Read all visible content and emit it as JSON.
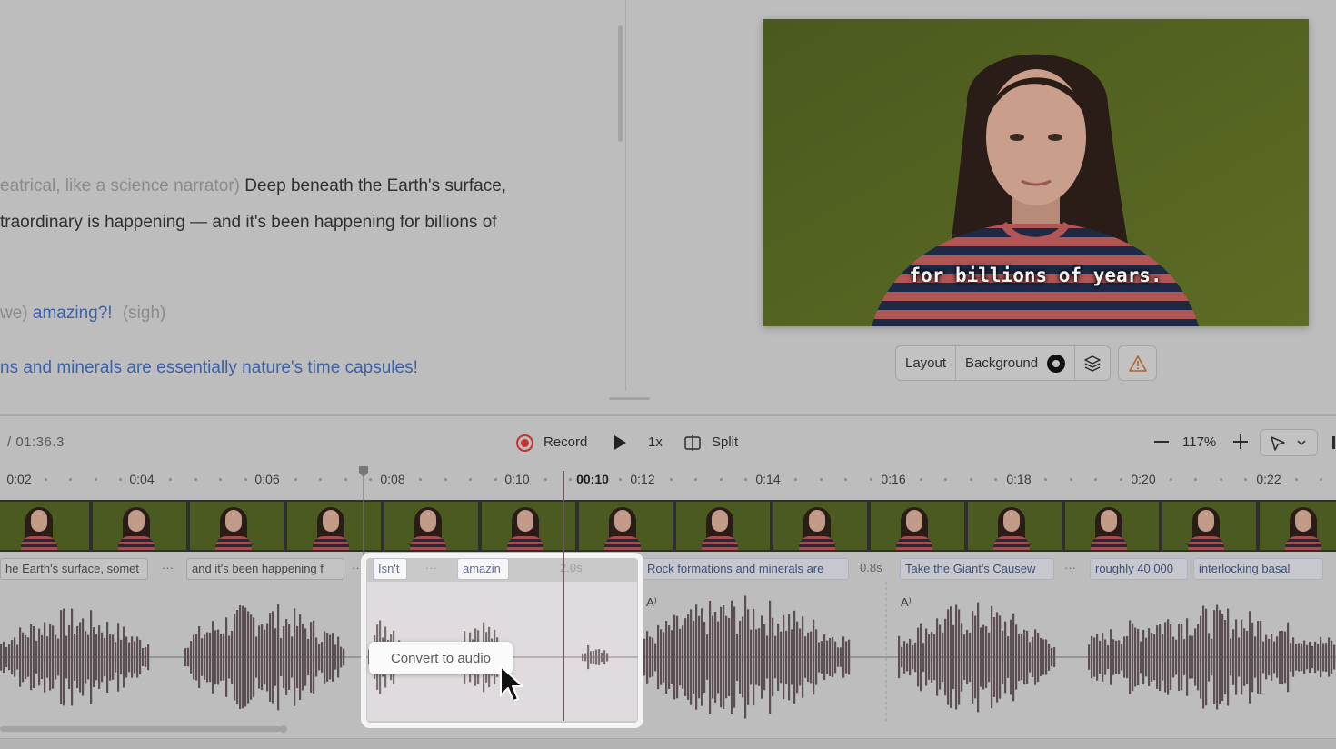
{
  "script": {
    "line1_direction": "eatrical, like a science narrator)",
    "line1_text": "Deep beneath the Earth's surface,",
    "line2_text": "traordinary is happening — and it's been happening for billions of",
    "line3_direction": "we)",
    "line3_word": "amazing?!",
    "line3_tag": "(sigh)",
    "line4_text": "ns and minerals are essentially nature's time capsules!"
  },
  "preview": {
    "caption": "for billions of years.",
    "toolbar": {
      "layout": "Layout",
      "background": "Background"
    }
  },
  "transport": {
    "time": "/  01:36.3",
    "record": "Record",
    "speed": "1x",
    "split": "Split",
    "zoom": "117%"
  },
  "ruler": {
    "labels": [
      "0:02",
      "0:04",
      "0:06",
      "0:08",
      "0:10",
      "00:10",
      "0:12",
      "0:14",
      "0:16",
      "0:18",
      "0:20",
      "0:22"
    ]
  },
  "segments": {
    "s1": "he Earth's surface, somet",
    "g1": "···",
    "s2": "and it's been happening f",
    "g2": "···",
    "s3": "Isn't",
    "g3": "···",
    "s4": "amazin",
    "g4": "2.0s",
    "s5": "Rock formations and minerals are",
    "g5": "0.8s",
    "s6": "Take the Giant's Causew",
    "g6": "···",
    "s7": "roughly 40,000",
    "s8": "interlocking basal"
  },
  "popup": {
    "label": "Convert to audio"
  },
  "icons": [
    "record-icon",
    "play-icon",
    "split-icon",
    "zoom-out-icon",
    "zoom-in-icon",
    "select-tool-icon",
    "chevron-down-icon",
    "layers-icon",
    "warning-icon",
    "tts-icon",
    "cursor-icon"
  ]
}
